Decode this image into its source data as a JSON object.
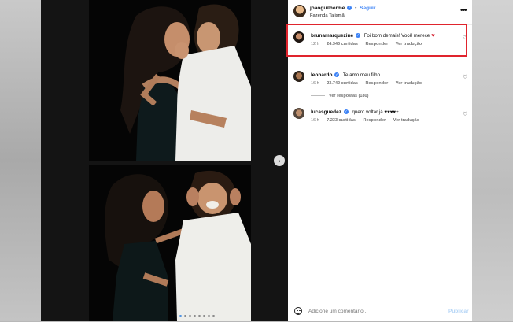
{
  "post": {
    "author": "joaoguilherme",
    "follow_label": "Seguir",
    "separator": "•",
    "location": "Fazenda Talismã",
    "more_label": "•••"
  },
  "comments": [
    {
      "username": "brunamarquezine",
      "text": "Foi bom demais! Você merece",
      "emoji": "❤",
      "time": "12 h",
      "likes": "24.343 curtidas",
      "reply_label": "Responder",
      "translate_label": "Ver tradução",
      "highlighted": true
    },
    {
      "username": "leonardo",
      "text": "Te amo meu filho",
      "time": "16 h",
      "likes": "23.742 curtidas",
      "reply_label": "Responder",
      "translate_label": "Ver tradução",
      "view_replies": "Ver respostas (180)"
    },
    {
      "username": "lucasguedez",
      "text": "quero voltar já ♥♥♥♥+",
      "time": "16 h",
      "likes": "7.233 curtidas",
      "reply_label": "Responder",
      "translate_label": "Ver tradução"
    }
  ],
  "composer": {
    "placeholder": "Adicione um comentário...",
    "publish_label": "Publicar"
  },
  "icons": {
    "heart": "heart-icon",
    "verified": "verified-badge-icon",
    "emoji": "emoji-icon",
    "next": "chevron-right-icon"
  },
  "carousel": {
    "current": 1,
    "total": 8
  },
  "colors": {
    "accent": "#3b82f6",
    "highlight_box": "#e0242d",
    "heart_red": "#d41c2c"
  }
}
